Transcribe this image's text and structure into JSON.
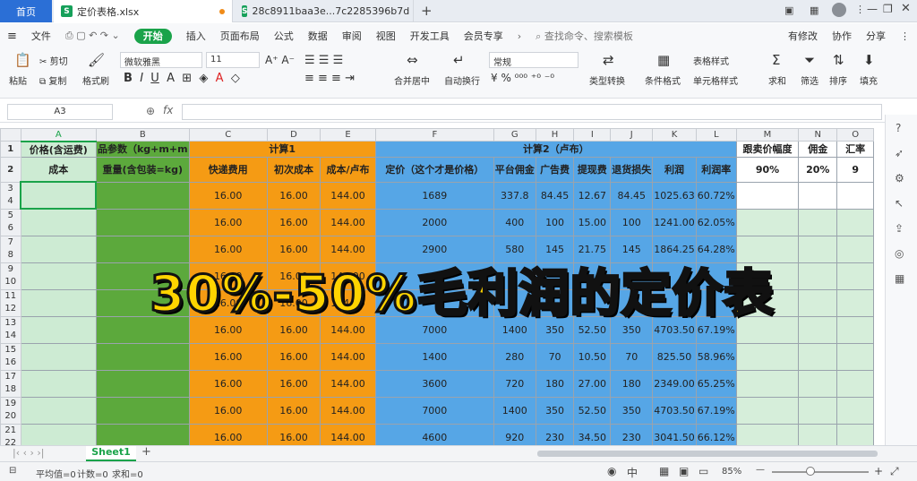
{
  "tabs": {
    "home": "首页",
    "file1": "定价表格.xlsx",
    "file2": "28c8911baa3e...7c2285396b7d",
    "new_tab": "+"
  },
  "menu": {
    "file": "文件",
    "items": [
      "开始",
      "插入",
      "页面布局",
      "公式",
      "数据",
      "审阅",
      "视图",
      "开发工具",
      "会员专享"
    ],
    "search": "查找命令、搜索模板",
    "changes": "有修改",
    "collab": "协作",
    "share": "分享"
  },
  "ribbon": {
    "cut": "剪切",
    "copy": "复制",
    "paste": "粘贴",
    "format_painter": "格式刷",
    "font": "微软雅黑",
    "size": "11",
    "merge": "合并居中",
    "wrap": "自动换行",
    "number_format": "常规",
    "convert": "类型转换",
    "cond_format": "条件格式",
    "table_style": "表格样式",
    "cell_style": "单元格样式",
    "sum": "求和",
    "filter": "筛选",
    "sort": "排序",
    "fill": "填充"
  },
  "formula": {
    "cell_ref": "A3",
    "fx": "fx",
    "value": ""
  },
  "columns": [
    "A",
    "B",
    "C",
    "D",
    "E",
    "F",
    "G",
    "H",
    "I",
    "J",
    "K",
    "L",
    "M",
    "N",
    "O"
  ],
  "header1": {
    "a": "价格(含运费)",
    "b": "品参数（kg+m+m",
    "calc1": "计算1",
    "calc2": "计算2（卢布）",
    "m": "跟卖价幅度",
    "n": "佣金",
    "o": "汇率"
  },
  "header2": {
    "a": "成本",
    "b": "重量(含包装=kg)",
    "c": "快递费用",
    "d": "初次成本",
    "e": "成本/卢布",
    "f": "定价（这个才是价格）",
    "g": "平台佣金",
    "h": "广告费",
    "i": "提现费",
    "j": "退货损失",
    "k": "利润",
    "l": "利润率",
    "m": "90%",
    "n": "20%",
    "o": "9"
  },
  "rows": [
    {
      "nums": [
        "3",
        "4"
      ],
      "c": "16.00",
      "d": "16.00",
      "e": "144.00",
      "f": "1689",
      "g": "337.8",
      "h": "84.45",
      "i": "12.67",
      "j": "84.45",
      "k": "1025.63",
      "l": "60.72%"
    },
    {
      "nums": [
        "5",
        "6"
      ],
      "c": "16.00",
      "d": "16.00",
      "e": "144.00",
      "f": "2000",
      "g": "400",
      "h": "100",
      "i": "15.00",
      "j": "100",
      "k": "1241.00",
      "l": "62.05%"
    },
    {
      "nums": [
        "7",
        "8"
      ],
      "c": "16.00",
      "d": "16.00",
      "e": "144.00",
      "f": "2900",
      "g": "580",
      "h": "145",
      "i": "21.75",
      "j": "145",
      "k": "1864.25",
      "l": "64.28%"
    },
    {
      "nums": [
        "9",
        "10"
      ],
      "c": "16.00",
      "d": "16.00",
      "e": "144.00",
      "f": "",
      "g": "",
      "h": "",
      "i": "",
      "j": "",
      "k": "",
      "l": ""
    },
    {
      "nums": [
        "11",
        "12"
      ],
      "c": "16.00",
      "d": "16.00",
      "e": "144.00",
      "f": "",
      "g": "",
      "h": "",
      "i": "",
      "j": "",
      "k": "",
      "l": ""
    },
    {
      "nums": [
        "13",
        "14"
      ],
      "c": "16.00",
      "d": "16.00",
      "e": "144.00",
      "f": "7000",
      "g": "1400",
      "h": "350",
      "i": "52.50",
      "j": "350",
      "k": "4703.50",
      "l": "67.19%"
    },
    {
      "nums": [
        "15",
        "16"
      ],
      "c": "16.00",
      "d": "16.00",
      "e": "144.00",
      "f": "1400",
      "g": "280",
      "h": "70",
      "i": "10.50",
      "j": "70",
      "k": "825.50",
      "l": "58.96%"
    },
    {
      "nums": [
        "17",
        "18"
      ],
      "c": "16.00",
      "d": "16.00",
      "e": "144.00",
      "f": "3600",
      "g": "720",
      "h": "180",
      "i": "27.00",
      "j": "180",
      "k": "2349.00",
      "l": "65.25%"
    },
    {
      "nums": [
        "19",
        "20"
      ],
      "c": "16.00",
      "d": "16.00",
      "e": "144.00",
      "f": "7000",
      "g": "1400",
      "h": "350",
      "i": "52.50",
      "j": "350",
      "k": "4703.50",
      "l": "67.19%"
    },
    {
      "nums": [
        "21",
        "22"
      ],
      "c": "16.00",
      "d": "16.00",
      "e": "144.00",
      "f": "4600",
      "g": "920",
      "h": "230",
      "i": "34.50",
      "j": "230",
      "k": "3041.50",
      "l": "66.12%"
    }
  ],
  "overlay": "30%-50%毛利润的定价表",
  "sheet": {
    "name": "Sheet1",
    "add": "+"
  },
  "status": {
    "avg": "平均值=0",
    "count": "计数=0",
    "sum": "求和=0",
    "zoom": "85%"
  },
  "colors": {
    "accent": "#1aa34a",
    "orange": "#f59b14",
    "blue": "#56a6e6",
    "green": "#5ca93c",
    "light_green": "#cdebd3",
    "overlay_text": "#ffd400"
  }
}
